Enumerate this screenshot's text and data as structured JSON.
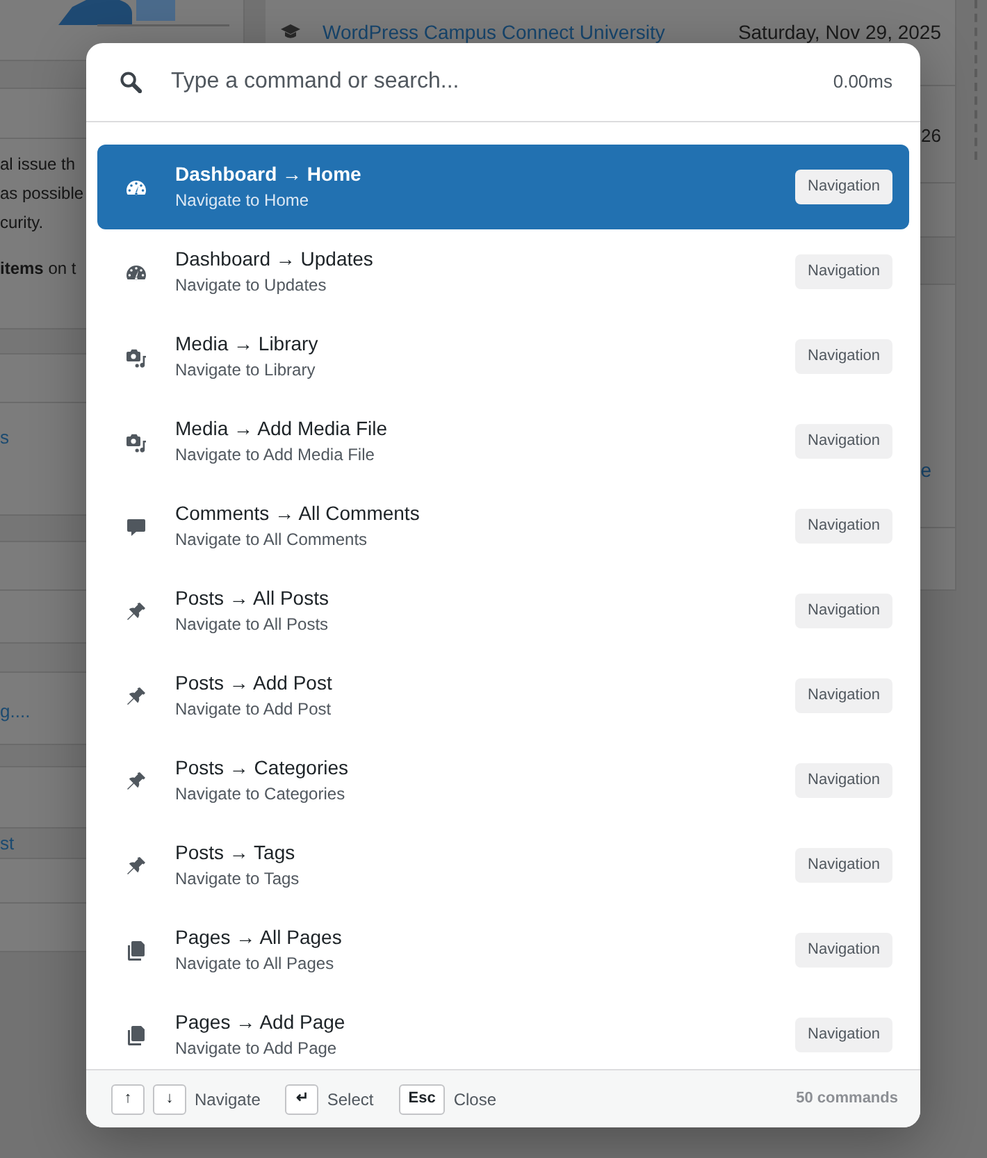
{
  "dashboard_behind": {
    "left_panel": {
      "paragraph_lines": [
        "al issue th",
        "as possible",
        "curity."
      ],
      "note": "**items** on t",
      "links": [
        "s",
        "g....",
        "st"
      ]
    },
    "right_panel": {
      "rows": [
        {
          "link": "WordPress Campus Connect University",
          "date": "Saturday, Nov 29, 2025"
        },
        {
          "date": "26"
        }
      ],
      "link": "e"
    }
  },
  "command_palette": {
    "search": {
      "placeholder": "Type a command or search..."
    },
    "timing": "0.00ms",
    "commands": [
      {
        "kind": "dashboard",
        "title": "Dashboard → Home",
        "subtitle": "Navigate to Home",
        "badge": "Navigation",
        "selected": true
      },
      {
        "kind": "dashboard",
        "title": "Dashboard → Updates",
        "subtitle": "Navigate to Updates",
        "badge": "Navigation",
        "selected": false
      },
      {
        "kind": "media",
        "title": "Media → Library",
        "subtitle": "Navigate to Library",
        "badge": "Navigation",
        "selected": false
      },
      {
        "kind": "media",
        "title": "Media → Add Media File",
        "subtitle": "Navigate to Add Media File",
        "badge": "Navigation",
        "selected": false
      },
      {
        "kind": "comments",
        "title": "Comments → All Comments",
        "subtitle": "Navigate to All Comments",
        "badge": "Navigation",
        "selected": false
      },
      {
        "kind": "post",
        "title": "Posts → All Posts",
        "subtitle": "Navigate to All Posts",
        "badge": "Navigation",
        "selected": false
      },
      {
        "kind": "post",
        "title": "Posts → Add Post",
        "subtitle": "Navigate to Add Post",
        "badge": "Navigation",
        "selected": false
      },
      {
        "kind": "post",
        "title": "Posts → Categories",
        "subtitle": "Navigate to Categories",
        "badge": "Navigation",
        "selected": false
      },
      {
        "kind": "post",
        "title": "Posts → Tags",
        "subtitle": "Navigate to Tags",
        "badge": "Navigation",
        "selected": false
      },
      {
        "kind": "page",
        "title": "Pages → All Pages",
        "subtitle": "Navigate to All Pages",
        "badge": "Navigation",
        "selected": false
      },
      {
        "kind": "page",
        "title": "Pages → Add Page",
        "subtitle": "Navigate to Add Page",
        "badge": "Navigation",
        "selected": false
      }
    ],
    "footer": {
      "hints": [
        {
          "keys": [
            "↑",
            "↓"
          ],
          "label": "Navigate"
        },
        {
          "keys": [
            "↵"
          ],
          "label": "Select"
        },
        {
          "keys": [
            "Esc"
          ],
          "label": "Close"
        }
      ],
      "count": "50 commands"
    }
  }
}
